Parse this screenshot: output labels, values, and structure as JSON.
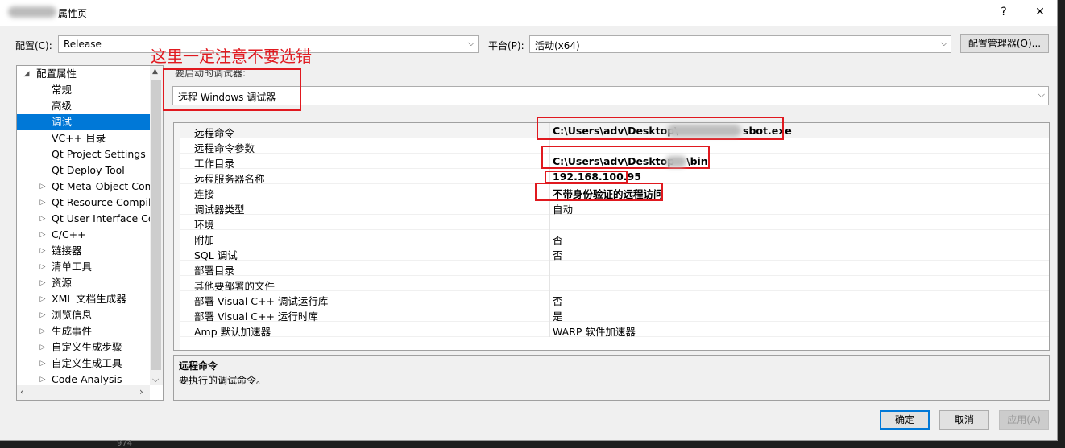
{
  "window": {
    "title": "属性页",
    "help_label": "?",
    "close_label": "✕"
  },
  "config_row": {
    "config_label": "配置(C):",
    "config_value": "Release",
    "platform_label": "平台(P):",
    "platform_value": "活动(x64)",
    "manager_button": "配置管理器(O)..."
  },
  "annotation": "这里一定注意不要选错",
  "debugger": {
    "label": "要启动的调试器:",
    "value": "远程 Windows 调试器"
  },
  "tree": {
    "root": "配置属性",
    "items": [
      {
        "label": "常规",
        "expandable": false
      },
      {
        "label": "高级",
        "expandable": false
      },
      {
        "label": "调试",
        "expandable": false,
        "selected": true
      },
      {
        "label": "VC++ 目录",
        "expandable": false
      },
      {
        "label": "Qt Project Settings",
        "expandable": false
      },
      {
        "label": "Qt Deploy Tool",
        "expandable": false
      },
      {
        "label": "Qt Meta-Object Com",
        "expandable": true
      },
      {
        "label": "Qt Resource Compile",
        "expandable": true
      },
      {
        "label": "Qt User Interface Co",
        "expandable": true
      },
      {
        "label": "C/C++",
        "expandable": true
      },
      {
        "label": "链接器",
        "expandable": true
      },
      {
        "label": "清单工具",
        "expandable": true
      },
      {
        "label": "资源",
        "expandable": true
      },
      {
        "label": "XML 文档生成器",
        "expandable": true
      },
      {
        "label": "浏览信息",
        "expandable": true
      },
      {
        "label": "生成事件",
        "expandable": true
      },
      {
        "label": "自定义生成步骤",
        "expandable": true
      },
      {
        "label": "自定义生成工具",
        "expandable": true
      },
      {
        "label": "Code Analysis",
        "expandable": true
      }
    ]
  },
  "properties": [
    {
      "name": "远程命令",
      "value": "C:\\Users\\adv\\Desktop\\",
      "value_tail": "sbot.exe",
      "bold": true
    },
    {
      "name": "远程命令参数",
      "value": ""
    },
    {
      "name": "工作目录",
      "value": "C:\\Users\\adv\\Desktop",
      "value_tail": "\\bin",
      "bold": true
    },
    {
      "name": "远程服务器名称",
      "value": "192.168.100.95",
      "bold": true
    },
    {
      "name": "连接",
      "value": "不带身份验证的远程访问",
      "bold": true
    },
    {
      "name": "调试器类型",
      "value": "自动"
    },
    {
      "name": "环境",
      "value": ""
    },
    {
      "name": "附加",
      "value": "否"
    },
    {
      "name": "SQL 调试",
      "value": "否"
    },
    {
      "name": "部署目录",
      "value": ""
    },
    {
      "name": "其他要部署的文件",
      "value": ""
    },
    {
      "name": "部署 Visual C++ 调试运行库",
      "value": "否"
    },
    {
      "name": "部署 Visual C++ 运行时库",
      "value": "是"
    },
    {
      "name": "Amp 默认加速器",
      "value": "WARP 软件加速器"
    }
  ],
  "description": {
    "title": "远程命令",
    "text": "要执行的调试命令。"
  },
  "buttons": {
    "ok": "确定",
    "cancel": "取消",
    "apply": "应用(A)"
  },
  "colors": {
    "accent": "#0078d7",
    "annotation_red": "#e0191f"
  }
}
